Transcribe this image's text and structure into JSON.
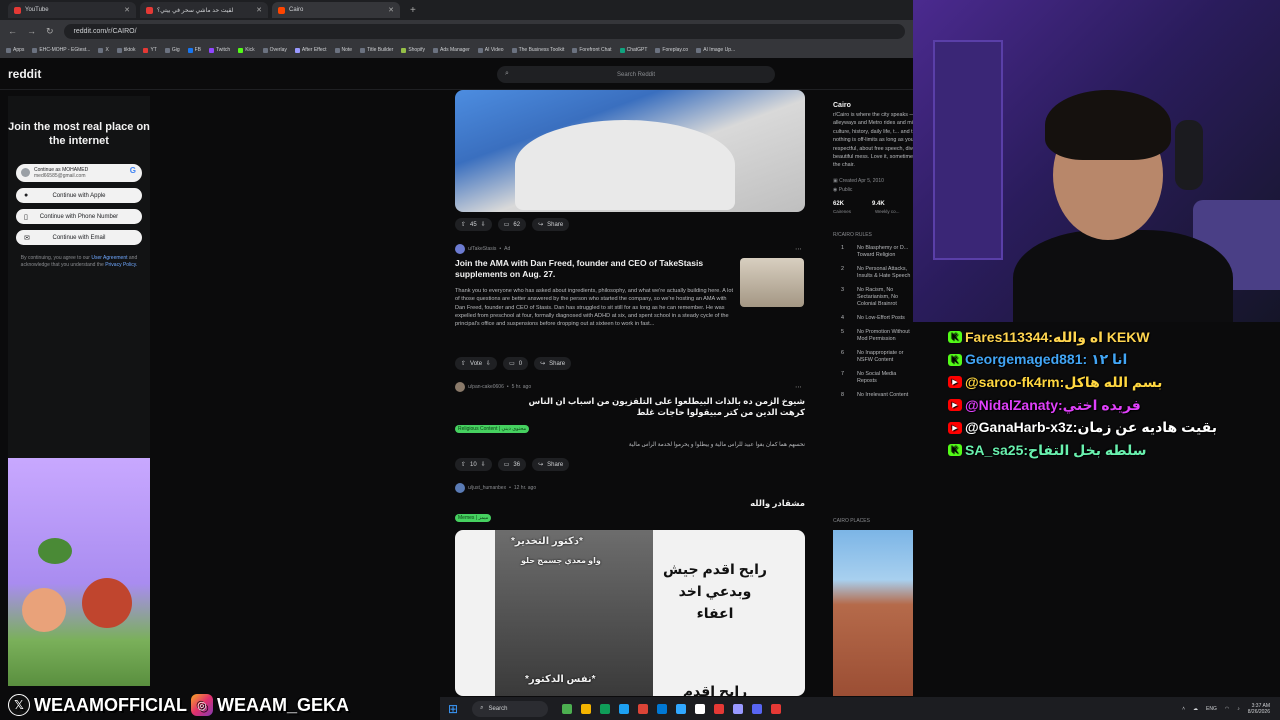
{
  "browser": {
    "tabs": [
      {
        "label": "YouTube"
      },
      {
        "label": "لقيت حد ماشي سحر في بيتي؟"
      },
      {
        "label": "Cairo"
      }
    ],
    "url": "reddit.com/r/CAIRO/",
    "bookmarks": [
      "Apps",
      "EHC-MOHP - EGtest...",
      "X",
      "tiktok",
      "YT",
      "Gig",
      "FB",
      "Twitch",
      "Kick",
      "Overlay",
      "After Effect",
      "Note",
      "Title Builder",
      "Shopify",
      "Ads Manager",
      "AI Video",
      "The Business Toolkit",
      "Forefront Chat",
      "ChatGPT",
      "Foreplay.co",
      "AI Image Up..."
    ]
  },
  "reddit": {
    "logo": "reddit",
    "search_placeholder": "Search Reddit"
  },
  "signin": {
    "title": "Join the most real place on the internet",
    "google_line1": "Continue as MOHAMED",
    "google_line2": "med66585@gmail.com",
    "apple": "Continue with Apple",
    "phone": "Continue with Phone Number",
    "email": "Continue with Email",
    "terms_pre": "By continuing, you agree to our",
    "terms_user": "User Agreement",
    "terms_mid": "and acknowledge that you understand the",
    "terms_privacy": "Privacy Policy."
  },
  "feed": {
    "post1": {
      "votes": "45",
      "comments": "62",
      "share": "Share"
    },
    "ad": {
      "author": "u/TakeStasis",
      "promo": "Ad",
      "title": "Join the AMA with Dan Freed, founder and CEO of TakeStasis supplements on Aug. 27.",
      "body": "Thank you to everyone who has asked about ingredients, philosophy, and what we're actually building here. A lot of those questions are better answered by the person who started the company, so we're hosting an AMA with Dan Freed, founder and CEO of Stasis. Dan has struggled to sit still for as long as he can remember. He was expelled from preschool at four, formally diagnosed with ADHD at six, and spent school in a steady cycle of the principal's office and suspensions before dropping out at sixteen to work in fast...",
      "vote": "Vote",
      "comments": "0",
      "share": "Share"
    },
    "post2": {
      "author": "u/pan-cake0606",
      "time": "5 hr. ago",
      "title": "شيوخ الزمن ده بالذات البيطلعوا على التلفزيون من اسباب ان الناس كرهت الدين من كتر مبيقولوا حاجات غلط",
      "flair": "Religious Content | محتوى ديني",
      "body": "نحسهم هما كمان بقوا عبيد للراس مالية و بيطلوا و يحرموا لخدمة الراس مالية",
      "votes": "10",
      "comments": "36",
      "share": "Share"
    },
    "post3": {
      "author": "u/just_humanbex",
      "time": "12 hr. ago",
      "title": "مشقادر والله",
      "flair": "Memes | ميمز",
      "meme_caption_top": "*دكتور التخدير*",
      "meme_caption_sub": "واو معدي جسمج حلو",
      "meme_text": "رايح اقدم جيش وبدعي اخد اعفاء",
      "meme_bottom": "*نفس الدكتور*",
      "meme_bottom_right": "رايح اقدم"
    }
  },
  "sidebar": {
    "name": "Cairo",
    "desc": "r/Cairo is where the city speaks — from ancient alleyways and Metro rides and midnight koshary, culture, history, daily life, t... and the \"ya rabi!\"—nothing is off-limits as long as you keep it respectful, about free speech, diverse... Cairo's beautiful mess. Love it, sometimes? You're still on the chair.",
    "created": "Created Apr 5, 2010",
    "public": "Public",
    "members": "62K",
    "members_label": "Cairenes",
    "weekly": "9.4K",
    "weekly_label": "Weekly co...",
    "rules_heading": "R/CAIRO RULES",
    "rules": [
      {
        "n": "1",
        "text": "No Blasphemy or D... Toward Religion"
      },
      {
        "n": "2",
        "text": "No Personal Attacks, Insults & Hate Speech"
      },
      {
        "n": "3",
        "text": "No Racism, No Sectarianism, No Colonial Brainrot"
      },
      {
        "n": "4",
        "text": "No Low-Effort Posts"
      },
      {
        "n": "5",
        "text": "No Promotion Without Mod Permission"
      },
      {
        "n": "6",
        "text": "No Inappropriate or NSFW Content"
      },
      {
        "n": "7",
        "text": "No Social Media Reposts"
      },
      {
        "n": "8",
        "text": "No Irrelevant Content"
      }
    ],
    "places_heading": "CAIRO PLACES"
  },
  "chat": [
    {
      "platform": "kick",
      "text": "Fares113344:اه والله KEKW",
      "color": "#ffd54f"
    },
    {
      "platform": "kick",
      "text": "Georgemaged881: انا ١٢",
      "color": "#42a5f5"
    },
    {
      "platform": "yt",
      "text": "@saroo-fk4rm:بسم الله هاكل",
      "color": "#ffd740"
    },
    {
      "platform": "yt",
      "text": "@NidalZanaty:فريده اختي",
      "color": "#e040fb"
    },
    {
      "platform": "yt",
      "text": "@GanaHarb-x3z:بقيت هاديه عن زمان",
      "color": "#ffffff"
    },
    {
      "platform": "kick",
      "text": "SA_sa25:سلطه بخل التفاح",
      "color": "#69f0ae"
    }
  ],
  "handles": {
    "x": "WEAAMOFFICIAL",
    "ig": "WEAAM_GEKA"
  },
  "taskbar": {
    "search": "Search",
    "lang": "ENG",
    "time": "3:37 AM",
    "date": "8/26/2026"
  }
}
